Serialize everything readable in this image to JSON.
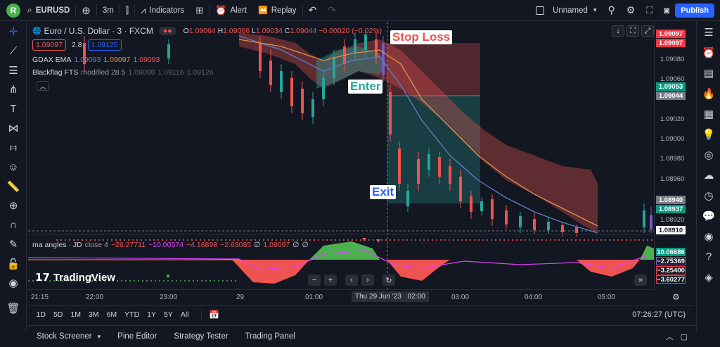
{
  "topbar": {
    "avatar": "R",
    "symbol": "EURUSD",
    "interval": "3m",
    "indicators": "Indicators",
    "alert": "Alert",
    "replay": "Replay",
    "layout_name": "Unnamed",
    "publish": "Publish"
  },
  "legend": {
    "title": "Euro / U.S. Dollar · 3 · FXCM",
    "o_label": "O",
    "o": "1.09064",
    "h_label": "H",
    "h": "1.09066",
    "l_label": "L",
    "l": "1.09034",
    "c_label": "C",
    "c": "1.09044",
    "change": "−0.00020 (−0.02%)",
    "bid": "1.09097",
    "spread": "2.8",
    "ask": "1.09125",
    "ind1_name": "GDAX EMA",
    "ind1_v1": "1.09093",
    "ind1_v2": "1.09097",
    "ind1_v3": "1.09093",
    "ind2_name": "Blackflag FTS",
    "ind2_params": "modified 28 5",
    "ind2_v1": "1.09098",
    "ind2_v2": "1.09116",
    "ind2_v3": "1.09126",
    "osc_name": "ma angles · JD",
    "osc_params": "close 4",
    "osc_v1": "−26.27711",
    "osc_v2": "−10.00574",
    "osc_v3": "−4.16898",
    "osc_v4": "−2.63085",
    "osc_v5": "∅",
    "osc_v6": "1.09097",
    "osc_v7": "∅",
    "osc_v8": "∅"
  },
  "annotations": {
    "stop_loss": "Stop Loss",
    "enter": "Enter",
    "exit": "Exit"
  },
  "watermark": "TradingView",
  "price_scale": {
    "ticks": [
      "1.09080",
      "1.09060",
      "1.09040",
      "1.09020",
      "1.09000",
      "1.08980",
      "1.08960",
      "1.08920"
    ],
    "badge_red1": "1.09097",
    "badge_red2": "1.09097",
    "badge_green": "1.09053",
    "badge_gray": "1.09044",
    "badge_gray2": "1.08940",
    "badge_green2": "1.08937",
    "badge_current": "1.08910",
    "osc_badges": [
      "10.06686",
      "−2.75369",
      "−3.25400",
      "−3.60277"
    ]
  },
  "time_scale": {
    "ticks": [
      "21:15",
      "22:00",
      "23:00",
      "29",
      "01:00",
      "03:00",
      "04:00",
      "05:00"
    ],
    "cursor": "Thu 29 Jun '23",
    "cursor_time": "02:00"
  },
  "ranges": [
    "1D",
    "5D",
    "1M",
    "3M",
    "6M",
    "YTD",
    "1Y",
    "5Y",
    "All"
  ],
  "clock": "07:26:27 (UTC)",
  "bottom_tabs": [
    "Stock Screener",
    "Pine Editor",
    "Strategy Tester",
    "Trading Panel"
  ],
  "colors": {
    "bg": "#131722",
    "up": "#26a69a",
    "down": "#ef5350",
    "accent": "#2962ff"
  }
}
